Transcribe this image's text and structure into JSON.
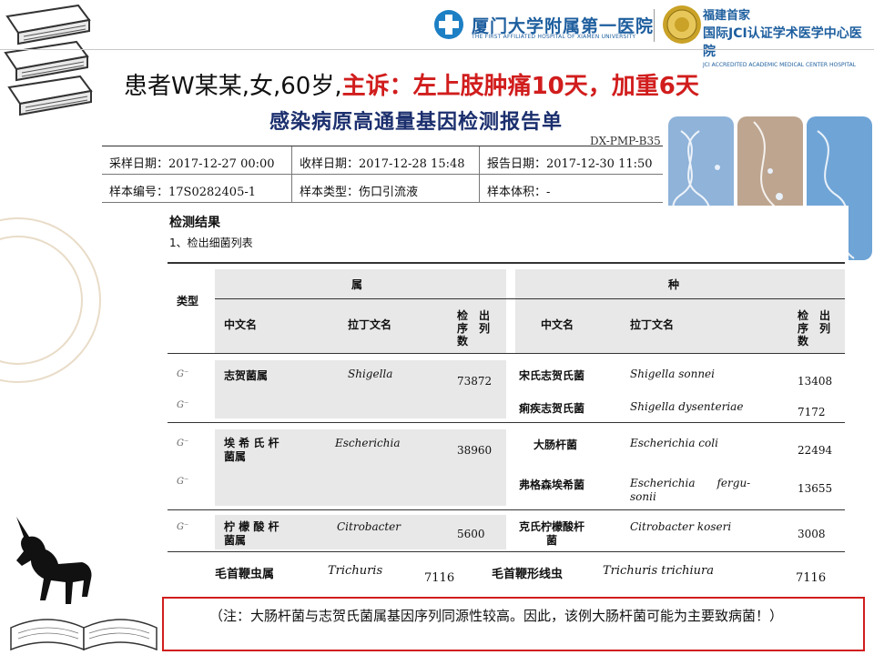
{
  "header": {
    "hospital1_cn": "厦门大学附属第一医院",
    "hospital1_en": "THE FIRST AFFILIATED HOSPITAL OF XIAMEN UNIVERSITY",
    "hospital2_line1": "福建首家",
    "hospital2_line2": "国际JCI认证学术医学中心医院",
    "hospital2_en": "JCI ACCREDITED ACADEMIC MEDICAL CENTER HOSPITAL"
  },
  "headline": {
    "patient": "患者W某某,女,60岁,",
    "complaint": "主诉：左上肢肿痛10天，加重6天"
  },
  "report": {
    "title": "感染病原高通量基因检测报告单",
    "code": "DX-PMP-B35",
    "info_rows": [
      [
        "采样日期：2017-12-27 00:00",
        "收样日期：2017-12-28 15:48",
        "报告日期：2017-12-30 11:50"
      ],
      [
        "样本编号：17S0282405-1",
        "样本类型：伤口引流液",
        "样本体积：-"
      ]
    ]
  },
  "results": {
    "heading": "检测结果",
    "subheading": "1、检出细菌列表",
    "col_type": "类型",
    "col_genus": "属",
    "col_species": "种",
    "col_cn_name": "中文名",
    "col_latin_name": "拉丁文名",
    "col_count_line1": "检　出",
    "col_count_line2": "序　列",
    "col_count_line3": "数",
    "rows": [
      {
        "type": "G⁻",
        "genus_cn": "志贺菌属",
        "genus_latin": "Shigella",
        "genus_count": "73872",
        "species_cn": "宋氏志贺氏菌",
        "species_latin": "Shigella sonnei",
        "species_count": "13408"
      },
      {
        "type": "G⁻",
        "species_cn": "痢疾志贺氏菌",
        "species_latin": "Shigella dysenteriae",
        "species_count": "7172"
      },
      {
        "type": "G⁻",
        "genus_cn_1": "埃 希 氏 杆",
        "genus_cn_2": "菌属",
        "genus_latin": "Escherichia",
        "genus_count": "38960",
        "species_cn": "大肠杆菌",
        "species_latin": "Escherichia coli",
        "species_count": "22494"
      },
      {
        "type": "G⁻",
        "species_cn": "弗格森埃希菌",
        "species_latin_1": "Escherichia　　fergu-",
        "species_latin_2": "sonii",
        "species_count": "13655"
      },
      {
        "type": "G⁻",
        "genus_cn_1": "柠 檬 酸 杆",
        "genus_cn_2": "菌属",
        "genus_latin": "Citrobacter",
        "genus_count": "5600",
        "species_cn_1": "克氏柠檬酸杆",
        "species_cn_2": "菌",
        "species_latin": "Citrobacter koseri",
        "species_count": "3008"
      },
      {
        "genus_cn": "毛首鞭虫属",
        "genus_latin": "Trichuris",
        "genus_count": "7116",
        "species_cn": "毛首鞭形线虫",
        "species_latin": "Trichuris trichiura",
        "species_count": "7116"
      }
    ]
  },
  "note": "（注：大肠杆菌与志贺氏菌属基因序列同源性较高。因此，该例大肠杆菌可能为主要致病菌！）",
  "colors": {
    "accent_red": "#d11d1d",
    "brand_blue": "#1d5e9e",
    "title_navy": "#1b2f6e"
  }
}
